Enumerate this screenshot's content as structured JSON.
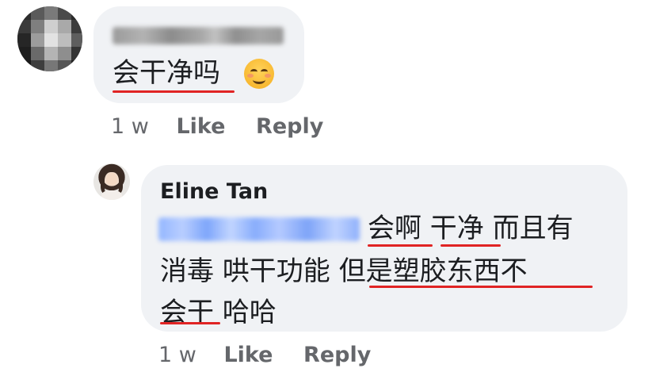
{
  "comments": [
    {
      "author": "",
      "text": "会干净吗",
      "emoji": "smiling-face-icon",
      "time": "1 w",
      "like_label": "Like",
      "reply_label": "Reply"
    },
    {
      "author": "Eline Tan",
      "line1": "会啊 干净 而且有",
      "line2": "消毒 哄干功能 但是塑胶东西不",
      "line3": "会干 哈哈",
      "time": "1 w",
      "like_label": "Like",
      "reply_label": "Reply"
    }
  ],
  "colors": {
    "bubble": "#f0f2f5",
    "underline": "#e02424",
    "meta": "#65676b",
    "mention_blur": "#93b6ff"
  }
}
